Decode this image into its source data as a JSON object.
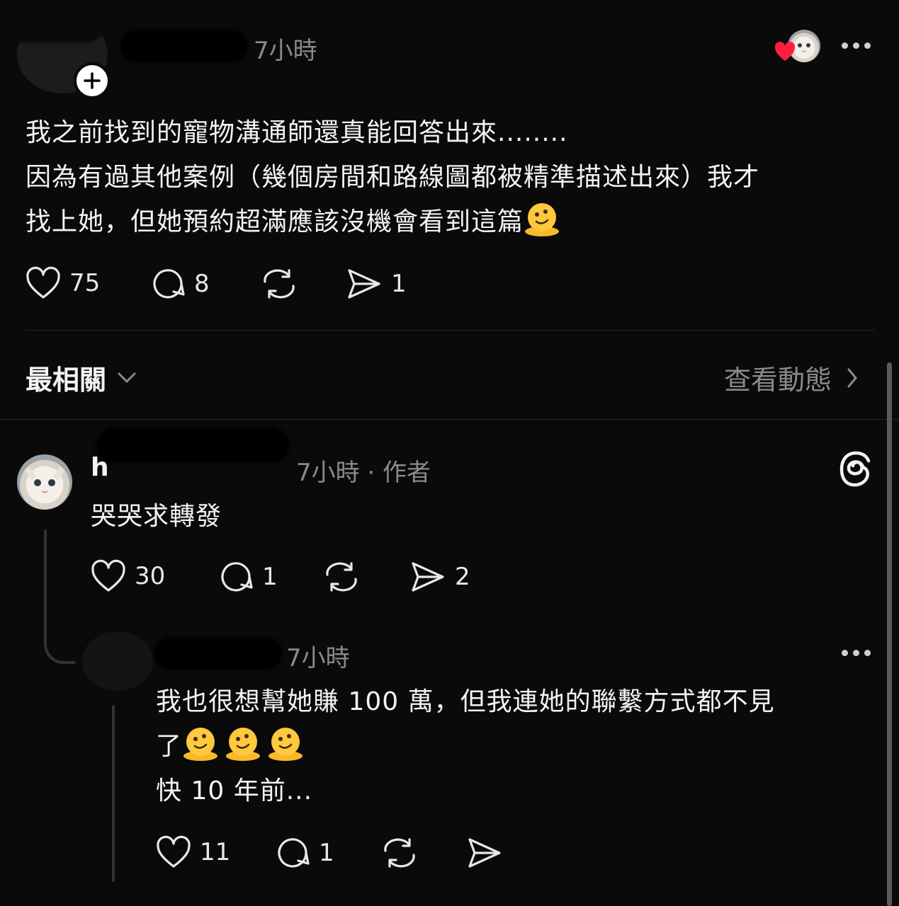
{
  "post": {
    "time": "7小時",
    "line1": "我之前找到的寵物溝通師還真能回答出來........",
    "line2": "因為有過其他案例（幾個房間和路線圖都被精準描述出來）我才",
    "line3": "找上她，但她預約超滿應該沒機會看到這篇",
    "likes": "75",
    "comments": "8",
    "shares": "1"
  },
  "sort": {
    "label": "最相關",
    "view_activity": "查看動態"
  },
  "reply1": {
    "username_visible": "h",
    "meta": "7小時 · 作者",
    "text": "哭哭求轉發",
    "likes": "30",
    "comments": "1",
    "shares": "2"
  },
  "reply2": {
    "time": "7小時",
    "line1": "我也很想幫她賺 100 萬，但我連她的聯繫方式都不見",
    "line2": "了",
    "line3": "快 10 年前...",
    "likes": "11",
    "comments": "1"
  },
  "icons": {
    "heart": "heart-icon",
    "comment": "comment-icon",
    "repost": "repost-icon",
    "share": "share-icon",
    "threads": "threads-logo-icon",
    "more": "more-dots-icon",
    "melting_face": "melting-face-emoji"
  },
  "colors": {
    "background": "#0a0a0a",
    "text": "#f3f3f3",
    "muted": "#8a8a8a",
    "liked_heart": "#ff1f3d"
  }
}
